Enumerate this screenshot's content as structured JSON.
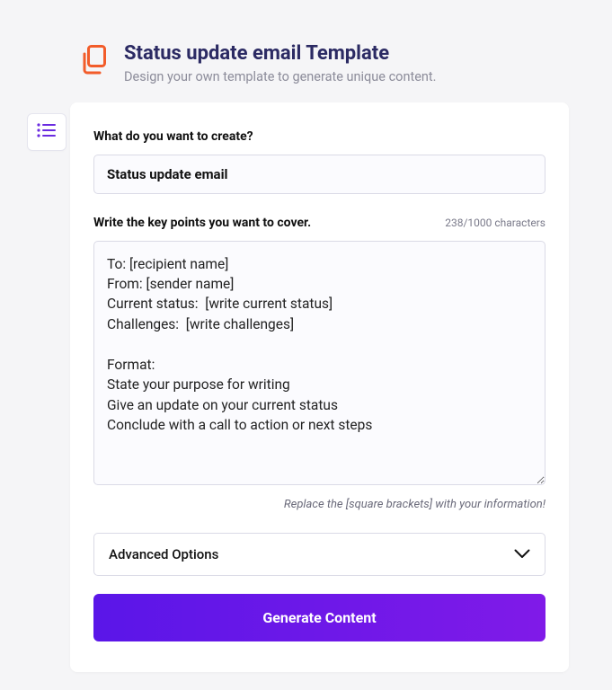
{
  "header": {
    "title": "Status update email Template",
    "subtitle": "Design your own template to generate unique content."
  },
  "form": {
    "create_label": "What do you want to create?",
    "create_value": "Status update email",
    "keypoints_label": "Write the key points you want to cover.",
    "keypoints_counter": "238/1000 characters",
    "keypoints_value": "To: [recipient name]\nFrom: [sender name]\nCurrent status:  [write current status]\nChallenges:  [write challenges]\n\nFormat:\nState your purpose for writing\nGive an update on your current status\nConclude with a call to action or next steps",
    "helper_text": "Replace the [square brackets] with your information!",
    "advanced_label": "Advanced Options",
    "generate_label": "Generate Content"
  }
}
